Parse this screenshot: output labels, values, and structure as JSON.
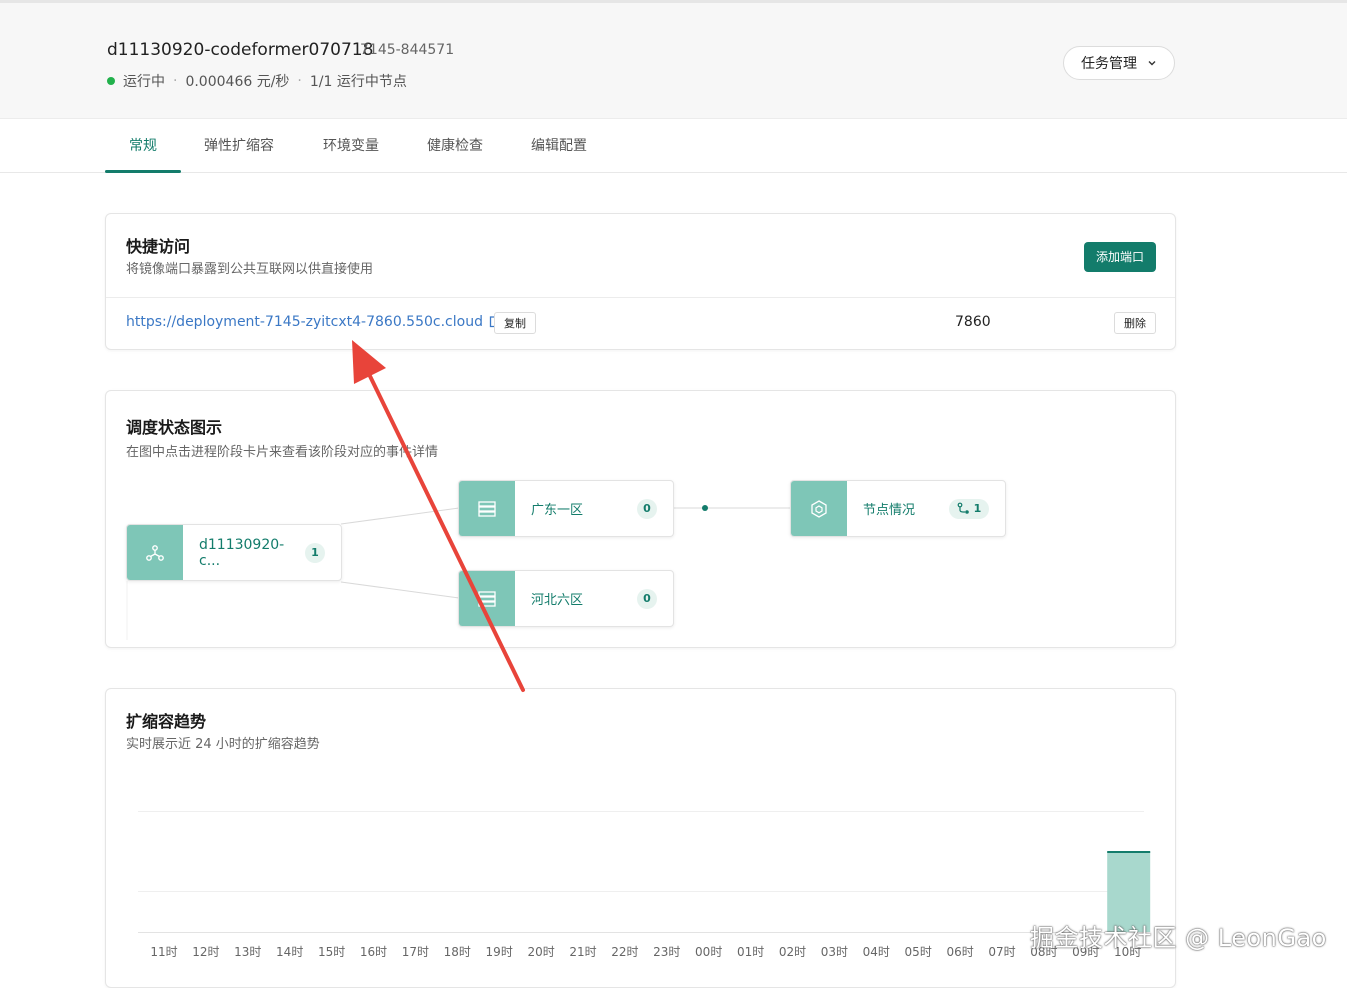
{
  "header": {
    "deployment_name": "d11130920-codeformer070718",
    "deployment_id": "7145-844571",
    "status": "运行中",
    "price": "0.000466 元/秒",
    "nodes": "1/1 运行中节点",
    "task_menu_label": "任务管理",
    "status_color": "#22b14c"
  },
  "tabs": [
    {
      "label": "常规",
      "active": true
    },
    {
      "label": "弹性扩缩容",
      "active": false
    },
    {
      "label": "环境变量",
      "active": false
    },
    {
      "label": "健康检查",
      "active": false
    },
    {
      "label": "编辑配置",
      "active": false
    }
  ],
  "quick_access": {
    "title": "快捷访问",
    "subtitle": "将镜像端口暴露到公共互联网以供直接使用",
    "add_port_label": "添加端口",
    "url": "https://deployment-7145-zyitcxt4-7860.550c.cloud",
    "copy_label": "复制",
    "port": "7860",
    "delete_label": "删除",
    "accent": "#137c6b"
  },
  "schedule": {
    "title": "调度状态图示",
    "subtitle": "在图中点击进程阶段卡片来查看该阶段对应的事件详情",
    "root_label": "d11130920-c...",
    "root_count": "1",
    "region_1_label": "广东一区",
    "region_1_count": "0",
    "region_2_label": "河北六区",
    "region_2_count": "0",
    "node_status_label": "节点情况",
    "node_status_count": "1",
    "node_color": "#7ec6b7"
  },
  "scaling": {
    "title": "扩缩容趋势",
    "subtitle": "实时展示近 24 小时的扩缩容趋势"
  },
  "chart_data": {
    "type": "area",
    "title": "",
    "xlabel": "",
    "ylabel": "",
    "categories": [
      "11时",
      "12时",
      "13时",
      "14时",
      "15时",
      "16时",
      "17时",
      "18时",
      "19时",
      "20时",
      "21时",
      "22时",
      "23时",
      "00时",
      "01时",
      "02时",
      "03时",
      "04时",
      "05时",
      "06时",
      "07时",
      "08时",
      "09时",
      "10时"
    ],
    "values": [
      0,
      0,
      0,
      0,
      0,
      0,
      0,
      0,
      0,
      0,
      0,
      0,
      0,
      0,
      0,
      0,
      0,
      0,
      0,
      0,
      0,
      0,
      0,
      1
    ],
    "ylim": [
      0,
      1.5
    ],
    "grid": true,
    "color": "#a8d8cd"
  },
  "watermark": "掘金技术社区 @ LeonGao"
}
